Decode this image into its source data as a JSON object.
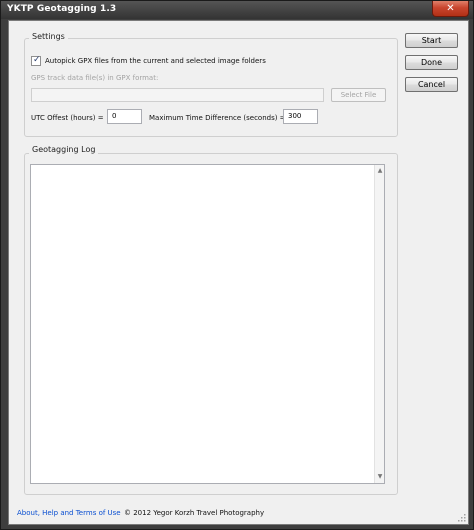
{
  "window": {
    "title": "YKTP Geotagging 1.3",
    "close_glyph": "✕"
  },
  "settings": {
    "group_title": "Settings",
    "autopick_label": "Autopick GPX files from the current and selected image folders",
    "autopick_checked": true,
    "gpx_label": "GPS track data file(s) in GPX format:",
    "gpx_value": "",
    "select_file_label": "Select File",
    "utc_label": "UTC Offest (hours) =",
    "utc_value": "0",
    "max_diff_label": "Maximum Time Difference (seconds) =",
    "max_diff_value": "300"
  },
  "buttons": {
    "start": "Start",
    "done": "Done",
    "cancel": "Cancel"
  },
  "log": {
    "group_title": "Geotagging Log",
    "content": "",
    "scroll_up_glyph": "▲",
    "scroll_down_glyph": "▼"
  },
  "footer": {
    "link_text": "About, Help and Terms of Use",
    "copyright": "© 2012 Yegor Korzh Travel Photography"
  },
  "icons": {
    "checkbox": "check-icon",
    "close": "close-icon",
    "resize": "resize-grip-icon"
  }
}
